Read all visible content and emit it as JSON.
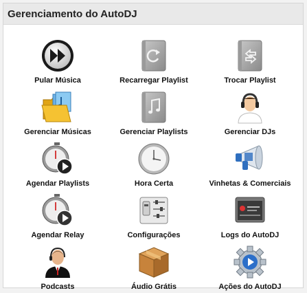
{
  "panel": {
    "title": "Gerenciamento do AutoDJ"
  },
  "items": [
    {
      "label": "Pular Música",
      "icon": "skip-forward-icon"
    },
    {
      "label": "Recarregar Playlist",
      "icon": "reload-icon"
    },
    {
      "label": "Trocar Playlist",
      "icon": "swap-icon"
    },
    {
      "label": "Gerenciar Músicas",
      "icon": "music-folder-icon"
    },
    {
      "label": "Gerenciar Playlists",
      "icon": "music-note-icon"
    },
    {
      "label": "Gerenciar DJs",
      "icon": "dj-headphones-icon"
    },
    {
      "label": "Agendar Playlists",
      "icon": "stopwatch-play-icon"
    },
    {
      "label": "Hora Certa",
      "icon": "clock-icon"
    },
    {
      "label": "Vinhetas & Comerciais",
      "icon": "megaphone-icon"
    },
    {
      "label": "Agendar Relay",
      "icon": "stopwatch-relay-icon"
    },
    {
      "label": "Configurações",
      "icon": "settings-panel-icon"
    },
    {
      "label": "Logs do AutoDJ",
      "icon": "log-window-icon"
    },
    {
      "label": "Podcasts",
      "icon": "podcast-speaker-icon"
    },
    {
      "label": "Áudio Grátis",
      "icon": "box-icon"
    },
    {
      "label": "Ações do AutoDJ",
      "icon": "gear-play-icon"
    }
  ]
}
